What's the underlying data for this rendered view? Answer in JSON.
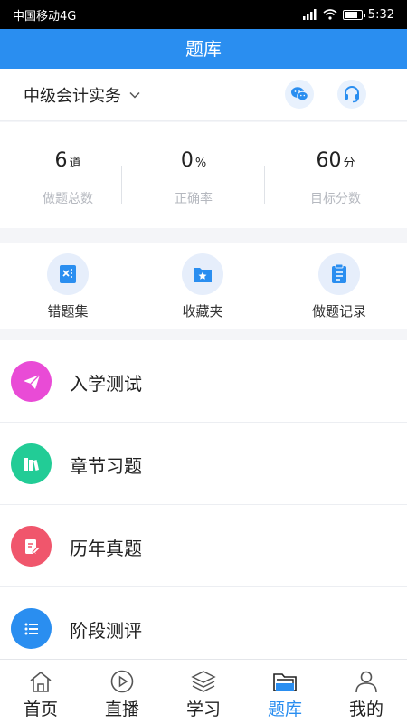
{
  "status_bar": {
    "carrier": "中国移动4G",
    "time": "5:32"
  },
  "header": {
    "title": "题库"
  },
  "subject": {
    "name": "中级会计实务"
  },
  "stats": [
    {
      "value": "6",
      "unit": "道",
      "label": "做题总数"
    },
    {
      "value": "0",
      "unit": "%",
      "label": "正确率"
    },
    {
      "value": "60",
      "unit": "分",
      "label": "目标分数"
    }
  ],
  "tools": [
    {
      "label": "错题集",
      "icon": "wrong-questions-icon"
    },
    {
      "label": "收藏夹",
      "icon": "favorites-folder-icon"
    },
    {
      "label": "做题记录",
      "icon": "practice-record-icon"
    }
  ],
  "menu": [
    {
      "label": "入学测试",
      "icon": "paper-plane-icon",
      "color": "#e94bd6"
    },
    {
      "label": "章节习题",
      "icon": "books-icon",
      "color": "#22cc96"
    },
    {
      "label": "历年真题",
      "icon": "exam-paper-icon",
      "color": "#f0566c"
    },
    {
      "label": "阶段测评",
      "icon": "list-icon",
      "color": "#2a8ef0"
    }
  ],
  "tabs": [
    {
      "label": "首页",
      "icon": "home-icon"
    },
    {
      "label": "直播",
      "icon": "live-play-icon"
    },
    {
      "label": "学习",
      "icon": "layers-icon"
    },
    {
      "label": "题库",
      "icon": "folder-icon",
      "active": true
    },
    {
      "label": "我的",
      "icon": "user-icon"
    }
  ],
  "colors": {
    "primary": "#2a8ef0",
    "muted": "#b5b8bf"
  }
}
